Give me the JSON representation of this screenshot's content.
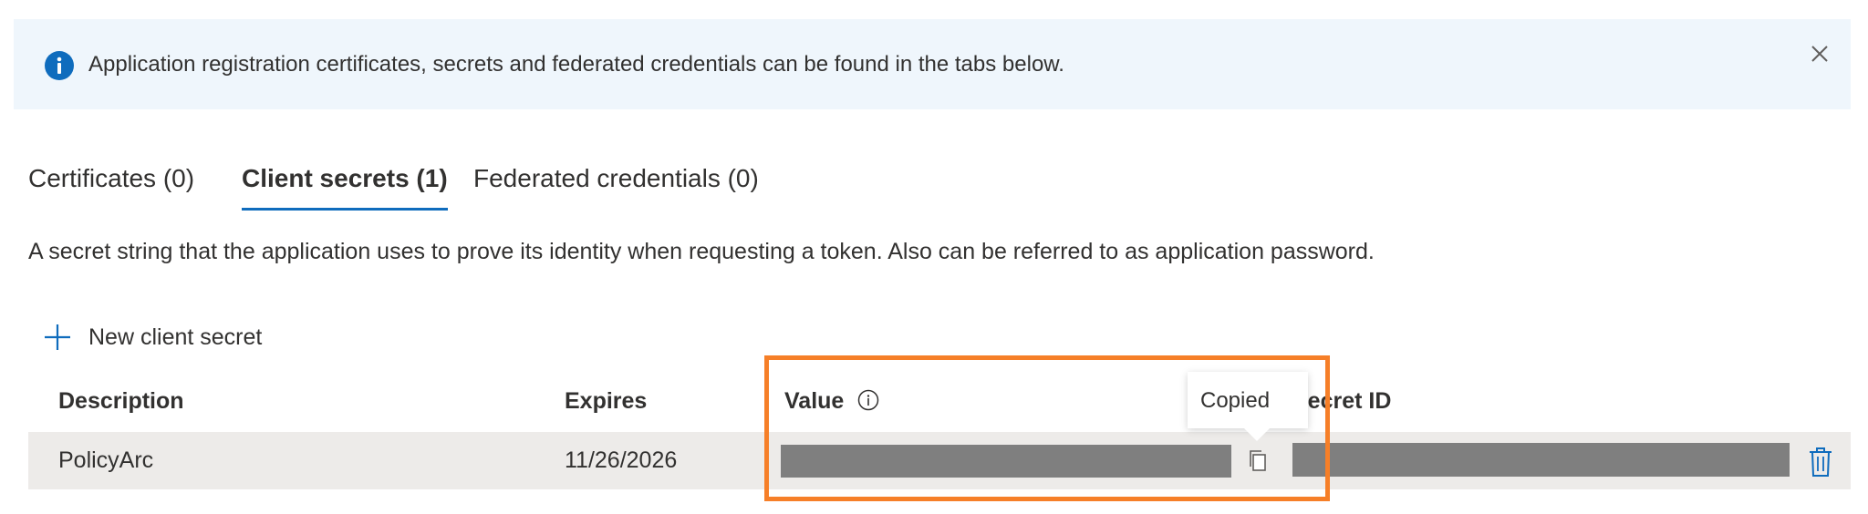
{
  "banner": {
    "text": "Application registration certificates, secrets and federated credentials can be found in the tabs below.",
    "icon": "info-icon",
    "close_icon": "close-icon"
  },
  "tabs": [
    {
      "label": "Certificates (0)",
      "active": false
    },
    {
      "label": "Client secrets (1)",
      "active": true
    },
    {
      "label": "Federated credentials (0)",
      "active": false
    }
  ],
  "description": "A secret string that the application uses to prove its identity when requesting a token. Also can be referred to as application password.",
  "toolbar": {
    "new_secret_label": "New client secret"
  },
  "table": {
    "headers": {
      "description": "Description",
      "expires": "Expires",
      "value": "Value",
      "secret_id": "Secret ID"
    },
    "rows": [
      {
        "description": "PolicyArc",
        "expires": "11/26/2026",
        "value": "",
        "secret_id": ""
      }
    ]
  },
  "tooltip": {
    "text": "Copied"
  },
  "colors": {
    "accent": "#0f6cbd",
    "banner_bg": "#eff6fc",
    "highlight": "#f67f28",
    "mask": "#7f7f7f",
    "row_bg": "#edebe9"
  }
}
